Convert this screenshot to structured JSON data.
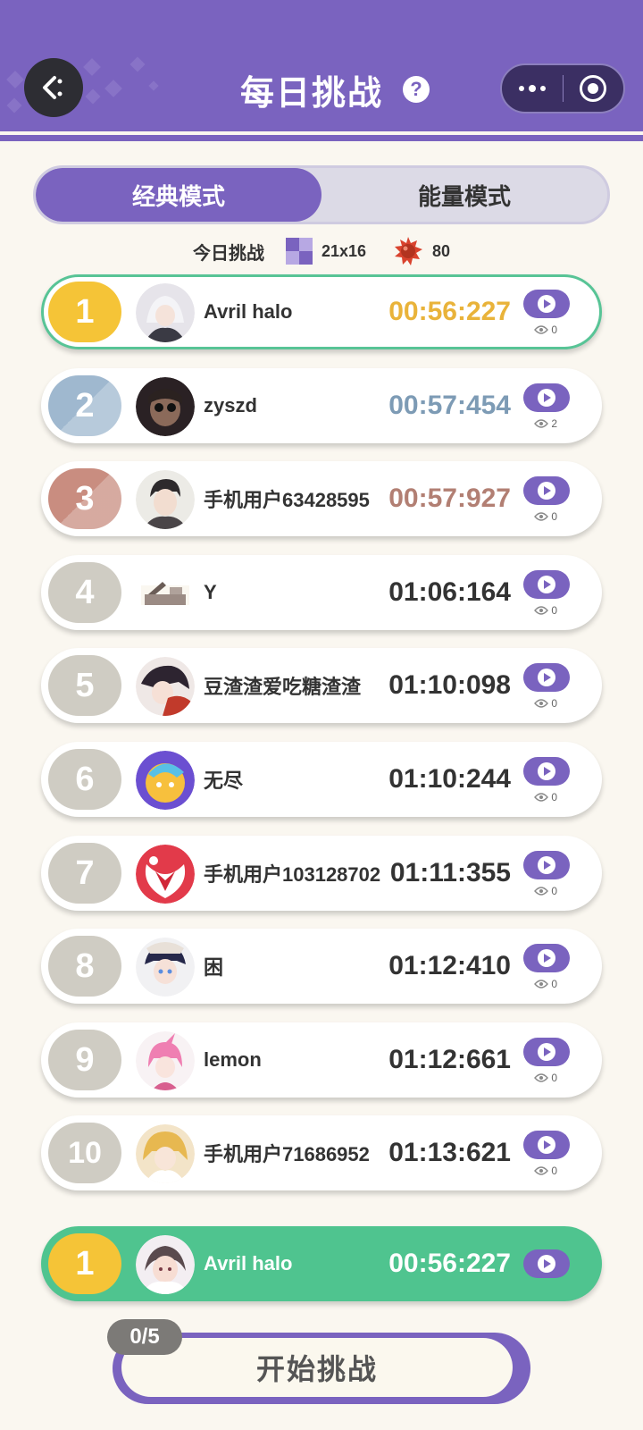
{
  "header": {
    "title": "每日挑战",
    "help_glyph": "?",
    "back_icon": "back-arrow-icon",
    "menu_icon": "more-dots-icon",
    "close_icon": "target-circle-icon",
    "color": "#7a63bf"
  },
  "mode_tabs": [
    {
      "label": "经典模式",
      "active": true
    },
    {
      "label": "能量模式",
      "active": false
    }
  ],
  "challenge_info": {
    "label": "今日挑战",
    "grid_size": "21x16",
    "mine_count": "80"
  },
  "rankings": [
    {
      "rank": "1",
      "name": "Avril halo",
      "time": "00:56:227",
      "views": "0",
      "badge_color": "#f5c437",
      "time_color": "#e9b33a"
    },
    {
      "rank": "2",
      "name": "zyszd",
      "time": "00:57:454",
      "views": "2",
      "badge_color": "#9fb8cf",
      "time_color": "#7d9bb5"
    },
    {
      "rank": "3",
      "name": "手机用户63428595",
      "time": "00:57:927",
      "views": "0",
      "badge_color": "#c98d80",
      "time_color": "#b27f73"
    },
    {
      "rank": "4",
      "name": "Y",
      "time": "01:06:164",
      "views": "0",
      "badge_color": "#cfccc3",
      "time_color": "#333333"
    },
    {
      "rank": "5",
      "name": "豆渣渣爱吃糖渣渣",
      "time": "01:10:098",
      "views": "0",
      "badge_color": "#cfccc3",
      "time_color": "#333333"
    },
    {
      "rank": "6",
      "name": "无尽",
      "time": "01:10:244",
      "views": "0",
      "badge_color": "#cfccc3",
      "time_color": "#333333"
    },
    {
      "rank": "7",
      "name": "手机用户103128702",
      "time": "01:11:355",
      "views": "0",
      "badge_color": "#cfccc3",
      "time_color": "#333333"
    },
    {
      "rank": "8",
      "name": "困",
      "time": "01:12:410",
      "views": "0",
      "badge_color": "#cfccc3",
      "time_color": "#333333"
    },
    {
      "rank": "9",
      "name": "lemon",
      "time": "01:12:661",
      "views": "0",
      "badge_color": "#cfccc3",
      "time_color": "#333333"
    },
    {
      "rank": "10",
      "name": "手机用户71686952",
      "time": "01:13:621",
      "views": "0",
      "badge_color": "#cfccc3",
      "time_color": "#333333"
    }
  ],
  "my_rank": {
    "rank": "1",
    "name": "Avril halo",
    "time": "00:56:227",
    "badge_color": "#f5c437"
  },
  "start": {
    "label": "开始挑战",
    "attempts": "0/5"
  }
}
